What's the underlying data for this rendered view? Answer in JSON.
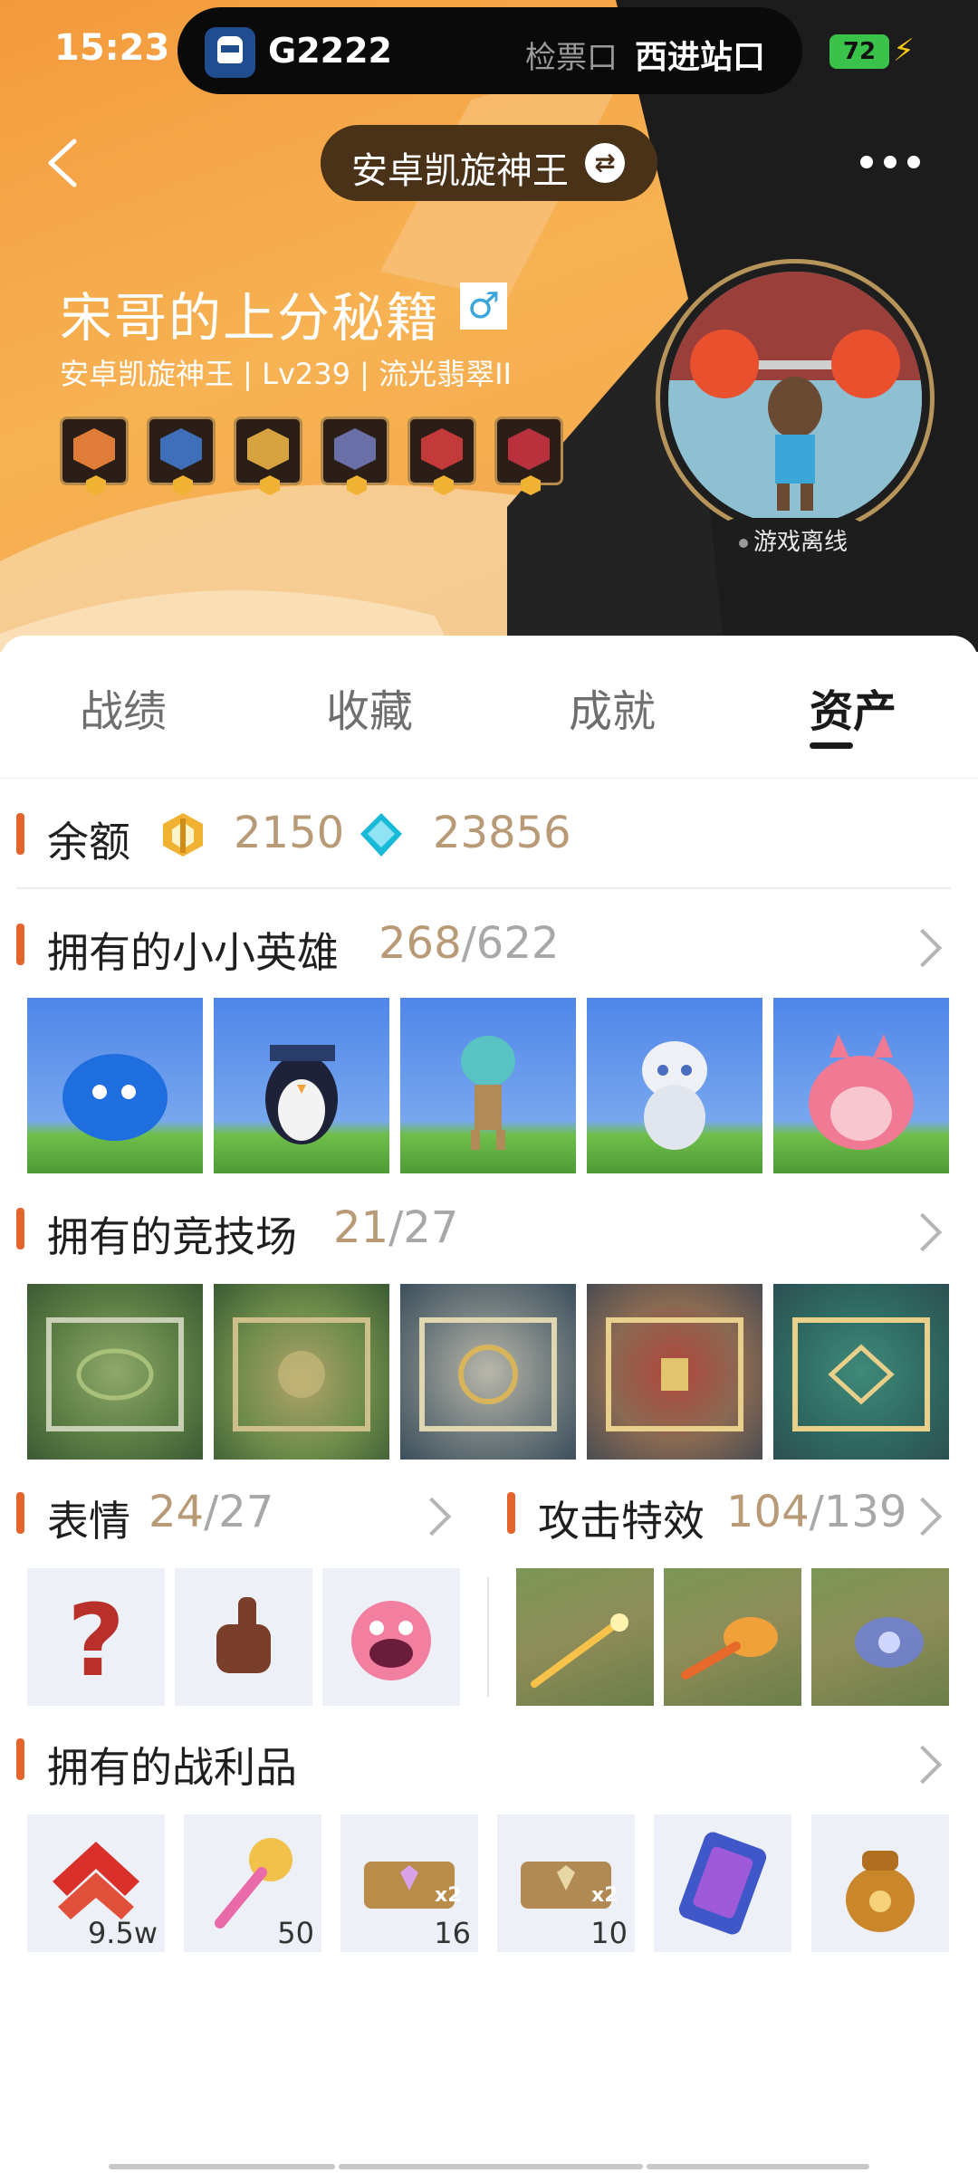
{
  "status_bar": {
    "time": "15:23",
    "train": "G2222",
    "gate_label": "检票口",
    "station": "西进站口",
    "battery": "72"
  },
  "header": {
    "server": "安卓凯旋神王",
    "nickname": "宋哥的上分秘籍",
    "gender_symbol": "♂",
    "sub_info": "安卓凯旋神王 | Lv239 | 流光翡翠II",
    "status": "游戏离线"
  },
  "tabs": [
    "战绩",
    "收藏",
    "成就",
    "资产"
  ],
  "active_tab": "资产",
  "balance": {
    "label": "余额",
    "gold": "2150",
    "gems": "23856"
  },
  "little_legends": {
    "title": "拥有的小小英雄",
    "owned": "268",
    "total": "/622"
  },
  "arenas": {
    "title": "拥有的竞技场",
    "owned": "21",
    "total": "/27"
  },
  "emotes": {
    "title": "表情",
    "owned": "24",
    "total": "/27"
  },
  "attack_effects": {
    "title": "攻击特效",
    "owned": "104",
    "total": "/139"
  },
  "loot": {
    "title": "拥有的战利品",
    "counts": [
      "9.5w",
      "50",
      "16",
      "10"
    ]
  },
  "colors": {
    "accent": "#e4652c",
    "count": "#b89a76",
    "hero_orange": "#f39a3c"
  }
}
